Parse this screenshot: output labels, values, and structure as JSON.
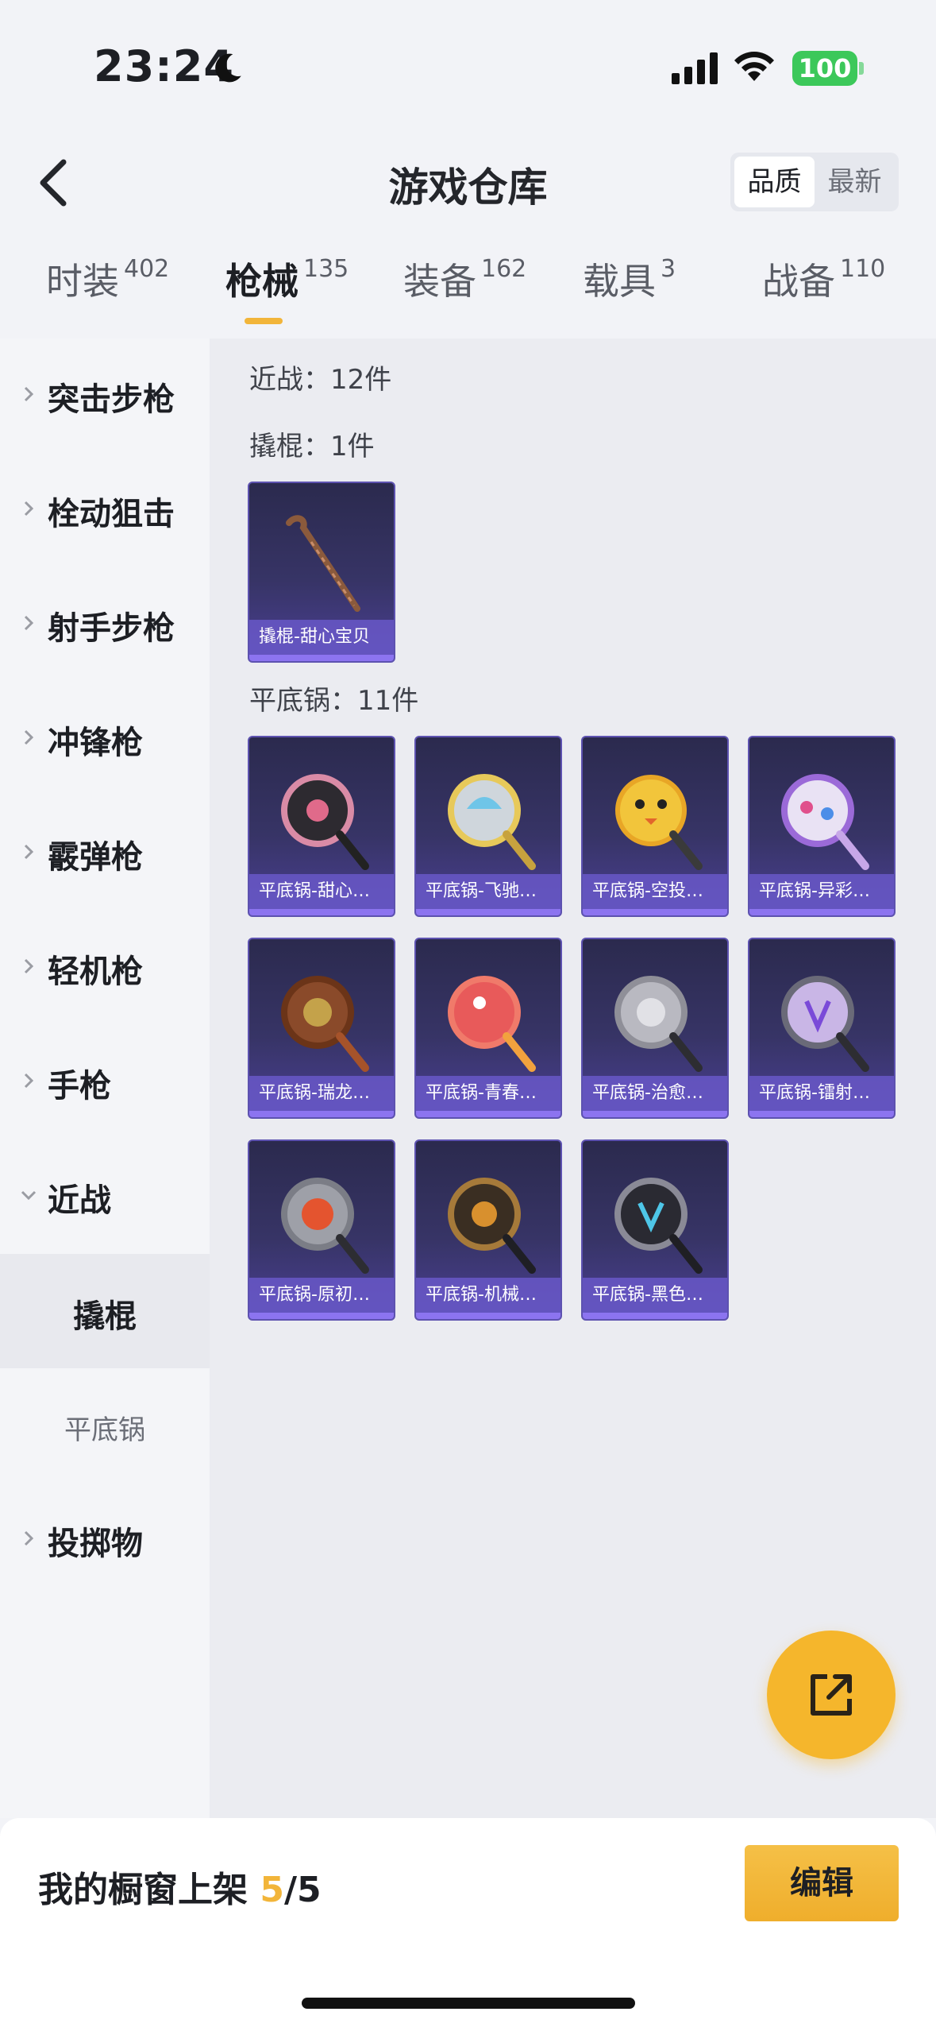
{
  "status_bar": {
    "time": "23:24",
    "battery": "100"
  },
  "nav": {
    "title": "游戏仓库",
    "segments": [
      "品质",
      "最新"
    ],
    "active_segment": 0
  },
  "tabs": [
    {
      "label": "时装",
      "count": "402"
    },
    {
      "label": "枪械",
      "count": "135"
    },
    {
      "label": "装备",
      "count": "162"
    },
    {
      "label": "载具",
      "count": "3"
    },
    {
      "label": "战备",
      "count": "110"
    }
  ],
  "sidebar": {
    "categories": [
      "突击步枪",
      "栓动狙击",
      "射手步枪",
      "冲锋枪",
      "霰弹枪",
      "轻机枪",
      "手枪",
      "近战"
    ],
    "subitems": [
      "撬棍",
      "平底锅"
    ],
    "after": "投掷物"
  },
  "content": {
    "melee_summary": "近战：12件",
    "crowbar_title": "撬棍：1件",
    "crowbar_items": [
      "撬棍-甜心宝贝"
    ],
    "pan_title": "平底锅：11件",
    "pan_items": [
      "平底锅-甜心…",
      "平底锅-飞驰…",
      "平底锅-空投…",
      "平底锅-异彩…",
      "平底锅-瑞龙…",
      "平底锅-青春…",
      "平底锅-治愈…",
      "平底锅-镭射…",
      "平底锅-原初…",
      "平底锅-机械…",
      "平底锅-黑色…"
    ]
  },
  "bottom": {
    "prefix": "我的橱窗上架 ",
    "count": "5",
    "suffix": "/5",
    "edit_label": "编辑"
  },
  "colors": {
    "accent": "#f2b53a",
    "card_bg": "#373466",
    "card_label": "#6958c8"
  }
}
